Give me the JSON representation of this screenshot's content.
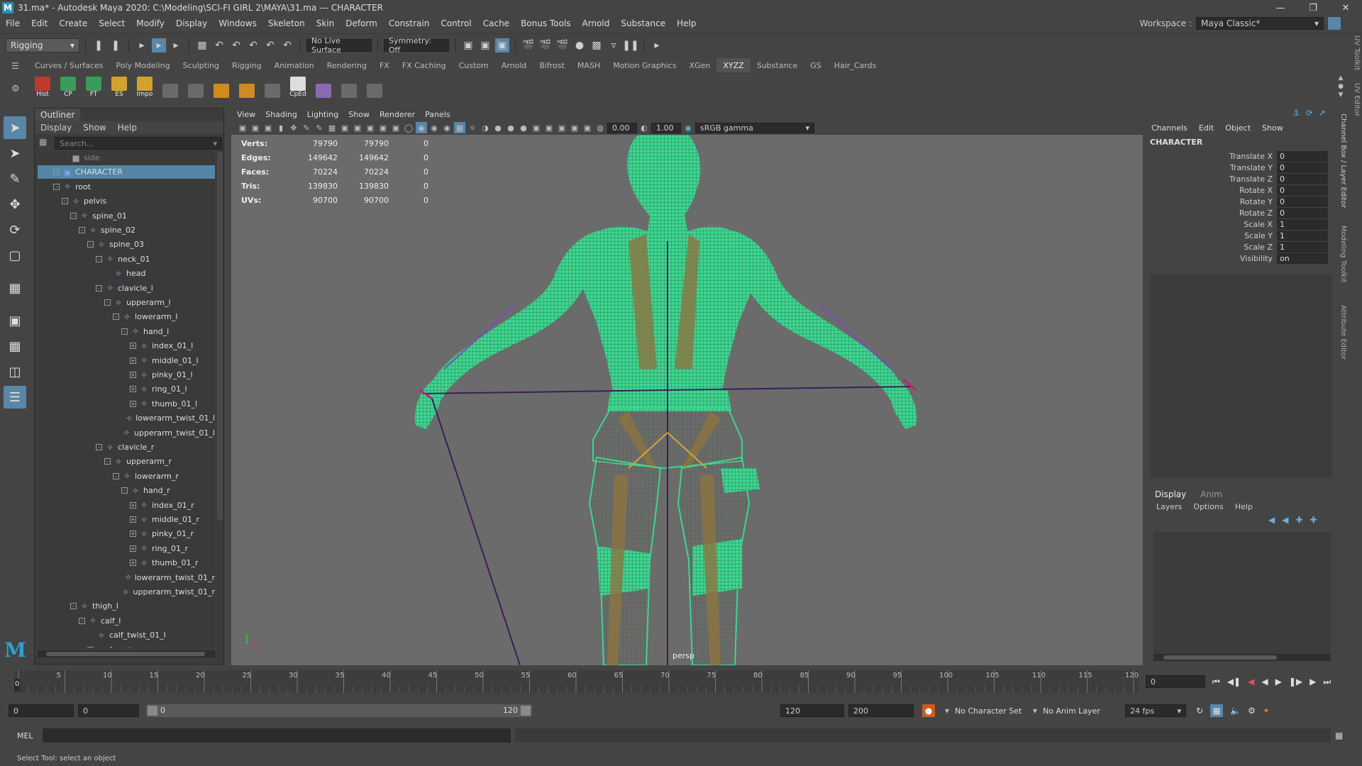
{
  "window": {
    "title": "31.ma* - Autodesk Maya 2020: C:\\Modeling\\SCI-FI GIRL 2\\MAYA\\31.ma  ---  CHARACTER",
    "logo": "M"
  },
  "menu": [
    "File",
    "Edit",
    "Create",
    "Select",
    "Modify",
    "Display",
    "Windows",
    "Skeleton",
    "Skin",
    "Deform",
    "Constrain",
    "Control",
    "Cache",
    "Bonus Tools",
    "Arnold",
    "Substance",
    "Help"
  ],
  "workspace": {
    "label": "Workspace :",
    "value": "Maya Classic*"
  },
  "statusline": {
    "mode": "Rigging",
    "live_surface": "No Live Surface",
    "symmetry": "Symmetry: Off"
  },
  "shelf_tabs": [
    "Curves / Surfaces",
    "Poly Modeling",
    "Sculpting",
    "Rigging",
    "Animation",
    "Rendering",
    "FX",
    "FX Caching",
    "Custom",
    "Arnold",
    "Bifrost",
    "MASH",
    "Motion Graphics",
    "XGen",
    "XYZZ",
    "Substance",
    "GS",
    "Hair_Cards"
  ],
  "shelf_active": "XYZZ",
  "shelf_buttons": [
    {
      "label": "Hist",
      "color": "#c0392b"
    },
    {
      "label": "CP",
      "color": "#3b9b5b"
    },
    {
      "label": "FT",
      "color": "#3b9b5b"
    },
    {
      "label": "ES",
      "color": "#d4a22a"
    },
    {
      "label": "Impo",
      "color": "#d4a22a"
    },
    {
      "label": "",
      "color": "#6a6a6a"
    },
    {
      "label": "",
      "color": "#6a6a6a"
    },
    {
      "label": "",
      "color": "#d08b1a"
    },
    {
      "label": "",
      "color": "#d08b1a"
    },
    {
      "label": "",
      "color": "#6a6a6a"
    },
    {
      "label": "CpEd",
      "color": "#dddddd"
    },
    {
      "label": "",
      "color": "#8a6ab0"
    },
    {
      "label": "",
      "color": "#6a6a6a"
    },
    {
      "label": "",
      "color": "#6a6a6a"
    }
  ],
  "outliner": {
    "tab": "Outliner",
    "menu": [
      "Display",
      "Show",
      "Help"
    ],
    "search_placeholder": "Search...",
    "rows": [
      {
        "label": "side",
        "indent": 2,
        "type": "camera",
        "exp": ""
      },
      {
        "label": "CHARACTER",
        "indent": 1,
        "type": "group",
        "exp": "-",
        "selected": true
      },
      {
        "label": "root",
        "indent": 1,
        "type": "joint",
        "exp": "-"
      },
      {
        "label": "pelvis",
        "indent": 2,
        "type": "joint",
        "exp": "-"
      },
      {
        "label": "spine_01",
        "indent": 3,
        "type": "joint",
        "exp": "-"
      },
      {
        "label": "spine_02",
        "indent": 4,
        "type": "joint",
        "exp": "-"
      },
      {
        "label": "spine_03",
        "indent": 5,
        "type": "joint",
        "exp": "-"
      },
      {
        "label": "neck_01",
        "indent": 6,
        "type": "joint",
        "exp": "-"
      },
      {
        "label": "head",
        "indent": 7,
        "type": "joint",
        "exp": ""
      },
      {
        "label": "clavicle_l",
        "indent": 6,
        "type": "joint",
        "exp": "-"
      },
      {
        "label": "upperarm_l",
        "indent": 7,
        "type": "joint",
        "exp": "-"
      },
      {
        "label": "lowerarm_l",
        "indent": 8,
        "type": "joint",
        "exp": "-"
      },
      {
        "label": "hand_l",
        "indent": 9,
        "type": "joint",
        "exp": "-"
      },
      {
        "label": "index_01_l",
        "indent": 10,
        "type": "joint",
        "exp": "+"
      },
      {
        "label": "middle_01_l",
        "indent": 10,
        "type": "joint",
        "exp": "+"
      },
      {
        "label": "pinky_01_l",
        "indent": 10,
        "type": "joint",
        "exp": "+"
      },
      {
        "label": "ring_01_l",
        "indent": 10,
        "type": "joint",
        "exp": "+"
      },
      {
        "label": "thumb_01_l",
        "indent": 10,
        "type": "joint",
        "exp": "+"
      },
      {
        "label": "lowerarm_twist_01_l",
        "indent": 9,
        "type": "joint",
        "exp": ""
      },
      {
        "label": "upperarm_twist_01_l",
        "indent": 8,
        "type": "joint",
        "exp": ""
      },
      {
        "label": "clavicle_r",
        "indent": 6,
        "type": "joint",
        "exp": "-"
      },
      {
        "label": "upperarm_r",
        "indent": 7,
        "type": "joint",
        "exp": "-"
      },
      {
        "label": "lowerarm_r",
        "indent": 8,
        "type": "joint",
        "exp": "-"
      },
      {
        "label": "hand_r",
        "indent": 9,
        "type": "joint",
        "exp": "-"
      },
      {
        "label": "index_01_r",
        "indent": 10,
        "type": "joint",
        "exp": "+"
      },
      {
        "label": "middle_01_r",
        "indent": 10,
        "type": "joint",
        "exp": "+"
      },
      {
        "label": "pinky_01_r",
        "indent": 10,
        "type": "joint",
        "exp": "+"
      },
      {
        "label": "ring_01_r",
        "indent": 10,
        "type": "joint",
        "exp": "+"
      },
      {
        "label": "thumb_01_r",
        "indent": 10,
        "type": "joint",
        "exp": "+"
      },
      {
        "label": "lowerarm_twist_01_r",
        "indent": 9,
        "type": "joint",
        "exp": ""
      },
      {
        "label": "upperarm_twist_01_r",
        "indent": 8,
        "type": "joint",
        "exp": ""
      },
      {
        "label": "thigh_l",
        "indent": 3,
        "type": "joint",
        "exp": "-"
      },
      {
        "label": "calf_l",
        "indent": 4,
        "type": "joint",
        "exp": "-"
      },
      {
        "label": "calf_twist_01_l",
        "indent": 5,
        "type": "joint",
        "exp": ""
      },
      {
        "label": "foot_l",
        "indent": 5,
        "type": "joint",
        "exp": "-"
      }
    ]
  },
  "viewport": {
    "menu": [
      "View",
      "Shading",
      "Lighting",
      "Show",
      "Renderer",
      "Panels"
    ],
    "exposure": "0.00",
    "gamma": "1.00",
    "colorspace": "sRGB gamma",
    "camera_label": "persp",
    "hud": [
      {
        "label": "Verts:",
        "a": "79790",
        "b": "79790",
        "c": "0"
      },
      {
        "label": "Edges:",
        "a": "149642",
        "b": "149642",
        "c": "0"
      },
      {
        "label": "Faces:",
        "a": "70224",
        "b": "70224",
        "c": "0"
      },
      {
        "label": "Tris:",
        "a": "139830",
        "b": "139830",
        "c": "0"
      },
      {
        "label": "UVs:",
        "a": "90700",
        "b": "90700",
        "c": "0"
      }
    ]
  },
  "channel_box": {
    "menu": [
      "Channels",
      "Edit",
      "Object",
      "Show"
    ],
    "object": "CHARACTER",
    "channels": [
      {
        "label": "Translate X",
        "value": "0"
      },
      {
        "label": "Translate Y",
        "value": "0"
      },
      {
        "label": "Translate Z",
        "value": "0"
      },
      {
        "label": "Rotate X",
        "value": "0"
      },
      {
        "label": "Rotate Y",
        "value": "0"
      },
      {
        "label": "Rotate Z",
        "value": "0"
      },
      {
        "label": "Scale X",
        "value": "1"
      },
      {
        "label": "Scale Y",
        "value": "1"
      },
      {
        "label": "Scale Z",
        "value": "1"
      },
      {
        "label": "Visibility",
        "value": "on"
      }
    ]
  },
  "layer_editor": {
    "tabs": [
      "Display",
      "Anim"
    ],
    "menu": [
      "Layers",
      "Options",
      "Help"
    ]
  },
  "side_tabs": [
    "Channel Box / Layer Editor",
    "Modeling Toolkit",
    "Attribute Editor"
  ],
  "side_tabs_top": [
    "UV Toolkit",
    "UV Editor"
  ],
  "timeline": {
    "ticks": [
      "0",
      "5",
      "10",
      "15",
      "20",
      "25",
      "30",
      "35",
      "40",
      "45",
      "50",
      "55",
      "60",
      "65",
      "70",
      "75",
      "80",
      "85",
      "90",
      "95",
      "100",
      "105",
      "110",
      "115",
      "120"
    ],
    "current": "0",
    "current_field": "0"
  },
  "range": {
    "start": "0",
    "anim_start": "0",
    "slider_start": "0",
    "slider_end": "120",
    "end": "120",
    "anim_end": "200",
    "character_set": "No Character Set",
    "anim_layer": "No Anim Layer",
    "fps": "24 fps"
  },
  "mel": {
    "label": "MEL"
  },
  "help_line": "Select Tool: select an object"
}
